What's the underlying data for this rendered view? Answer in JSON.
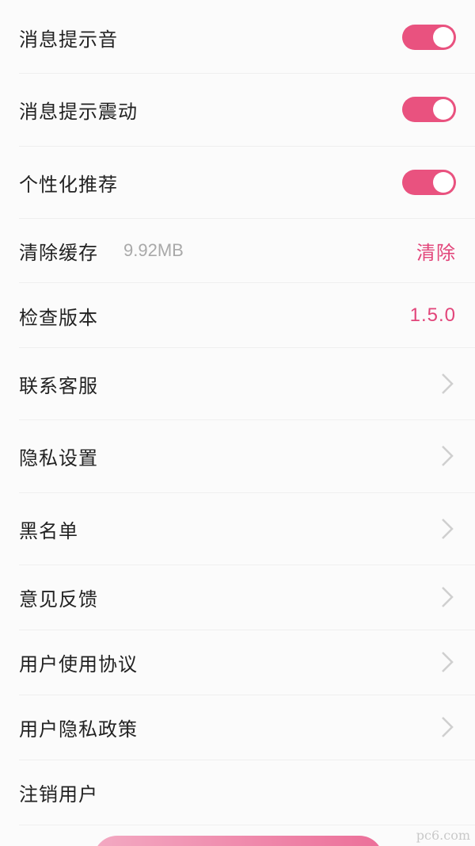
{
  "settings": {
    "message_sound": {
      "label": "消息提示音",
      "enabled": true
    },
    "message_vibration": {
      "label": "消息提示震动",
      "enabled": true
    },
    "personalized_recommendation": {
      "label": "个性化推荐",
      "enabled": true
    },
    "clear_cache": {
      "label": "清除缓存",
      "size": "9.92MB",
      "action": "清除"
    },
    "check_version": {
      "label": "检查版本",
      "version": "1.5.0"
    },
    "contact_service": {
      "label": "联系客服"
    },
    "privacy_settings": {
      "label": "隐私设置"
    },
    "blacklist": {
      "label": "黑名单"
    },
    "feedback": {
      "label": "意见反馈"
    },
    "user_agreement": {
      "label": "用户使用协议"
    },
    "privacy_policy": {
      "label": "用户隐私政策"
    },
    "cancel_account": {
      "label": "注销用户"
    }
  },
  "colors": {
    "accent": "#e2457a",
    "toggle_on": "#e9527f"
  },
  "watermark": "pc6.com"
}
